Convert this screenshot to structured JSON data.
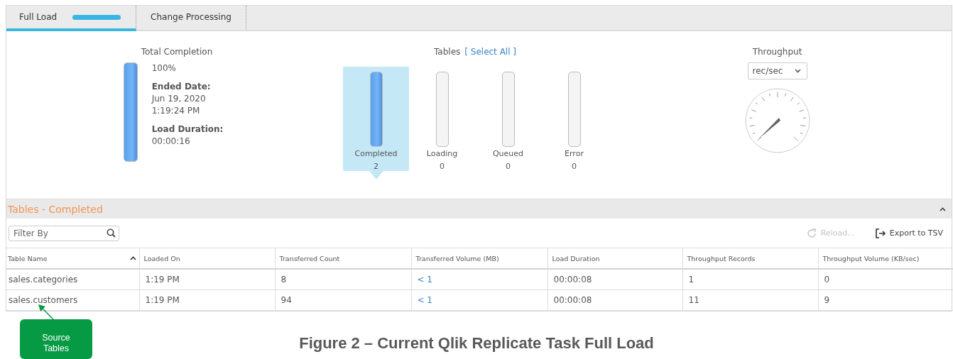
{
  "tabs": [
    {
      "label": "Full Load",
      "selected": true,
      "progress": true
    },
    {
      "label": "Change Processing",
      "selected": false,
      "progress": false
    }
  ],
  "total_completion": {
    "title": "Total Completion",
    "level": 1,
    "percent": "100%",
    "ended_label": "Ended Date:",
    "ended_date": "Jun 19, 2020",
    "ended_time": "1:19:24 PM",
    "duration_label": "Load Duration:",
    "duration": "00:00:16"
  },
  "tables_summary": {
    "title": "Tables",
    "select_all": "[ Select All ]",
    "items": [
      {
        "label": "Completed",
        "count": "2",
        "level": 1,
        "selected": true
      },
      {
        "label": "Loading",
        "count": "0",
        "level": 0,
        "selected": false
      },
      {
        "label": "Queued",
        "count": "0",
        "level": 0,
        "selected": false
      },
      {
        "label": "Error",
        "count": "0",
        "level": 0,
        "selected": false
      }
    ]
  },
  "throughput": {
    "title": "Throughput",
    "unit": "rec/sec"
  },
  "section": {
    "title": "Tables - Completed",
    "expanded": true
  },
  "filter": {
    "placeholder": "Filter By"
  },
  "actions": [
    {
      "label": "Reload...",
      "kind": "reload",
      "disabled": true
    },
    {
      "label": "Export to TSV",
      "kind": "export",
      "disabled": false
    }
  ],
  "table": {
    "columns": [
      {
        "label": "Table Name",
        "sorted": true,
        "kind": "text"
      },
      {
        "label": "Loaded On",
        "sorted": false,
        "kind": "text"
      },
      {
        "label": "Transferred Count",
        "sorted": false,
        "kind": "text"
      },
      {
        "label": "Transferred Volume (MB)",
        "sorted": false,
        "kind": "link"
      },
      {
        "label": "Load Duration",
        "sorted": false,
        "kind": "text"
      },
      {
        "label": "Throughput Records",
        "sorted": false,
        "kind": "text"
      },
      {
        "label": "Throughput Volume (KB/sec)",
        "sorted": false,
        "kind": "text"
      }
    ],
    "rows": [
      [
        "sales.categories",
        "1:19 PM",
        "8",
        "< 1",
        "00:00:08",
        "1",
        "0"
      ],
      [
        "sales.customers",
        "1:19 PM",
        "94",
        "< 1",
        "00:00:08",
        "11",
        "9"
      ]
    ]
  },
  "callout": {
    "text": "Source Tables"
  },
  "caption": "Figure 2 – Current Qlik Replicate Task Full Load"
}
